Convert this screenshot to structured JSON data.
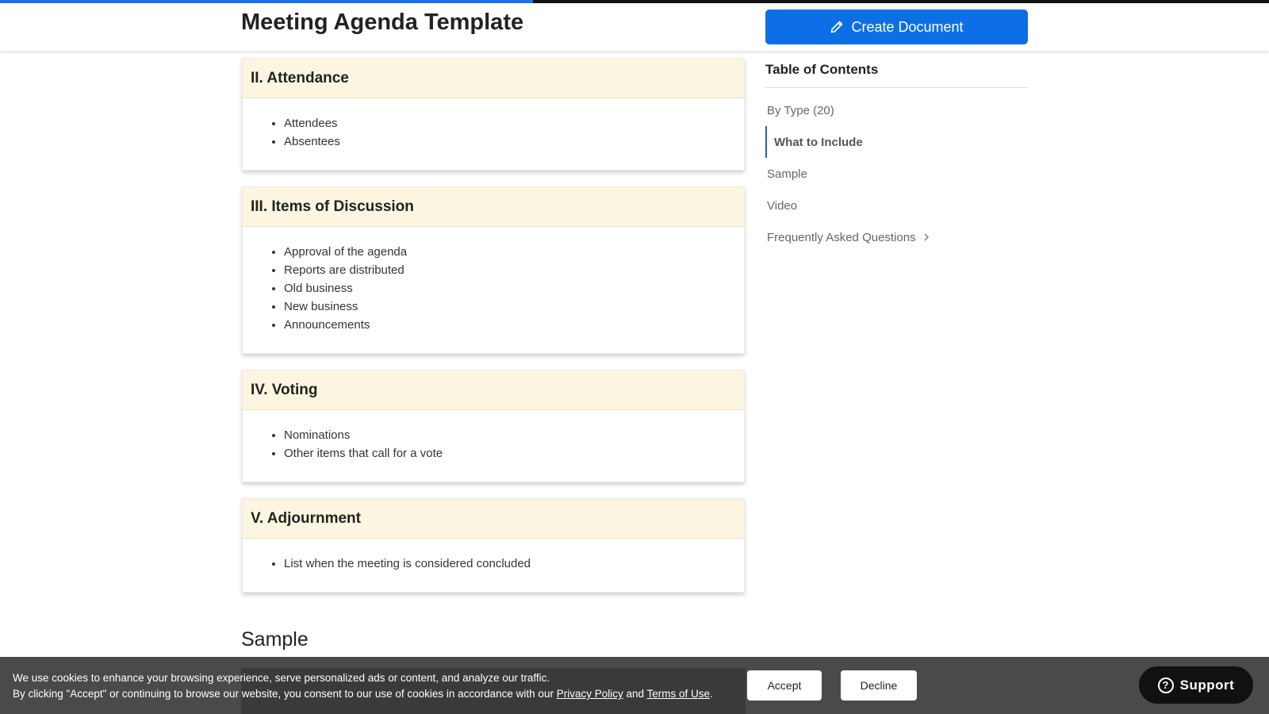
{
  "header": {
    "title": "Meeting Agenda Template",
    "create_button_label": "Create Document",
    "scroll_progress": 0.42
  },
  "sections": [
    {
      "heading": "II. Attendance",
      "items": [
        "Attendees",
        "Absentees"
      ]
    },
    {
      "heading": "III. Items of Discussion",
      "items": [
        "Approval of the agenda",
        "Reports are distributed",
        "Old business",
        "New business",
        "Announcements"
      ]
    },
    {
      "heading": "IV. Voting",
      "items": [
        "Nominations",
        "Other items that call for a vote"
      ]
    },
    {
      "heading": "V. Adjournment",
      "items": [
        "List when the meeting is considered concluded"
      ]
    }
  ],
  "sample_heading": "Sample",
  "toc": {
    "title": "Table of Contents",
    "items": [
      {
        "label": "By Type (20)",
        "active": false
      },
      {
        "label": "What to Include",
        "active": true
      },
      {
        "label": "Sample",
        "active": false
      },
      {
        "label": "Video",
        "active": false
      },
      {
        "label": "Frequently Asked Questions",
        "active": false
      }
    ]
  },
  "cookie_banner": {
    "line1": "We use cookies to enhance your browsing experience, serve personalized ads or content, and analyze our traffic.",
    "line2_prefix": "By clicking \"Accept\" or continuing to browse our website, you consent to our use of cookies in accordance with our ",
    "privacy_link": "Privacy Policy",
    "and_text": " and ",
    "terms_link": "Terms of Use",
    "period": ".",
    "accept_label": "Accept",
    "decline_label": "Decline"
  },
  "support": {
    "label": "Support"
  },
  "colors": {
    "brand_blue": "#0c6fe6",
    "section_header_bg": "#fcf6e0",
    "toc_active_border": "#2c5fa8"
  },
  "icons": {
    "create": "pencil-icon",
    "toc_expand": "chevron-right-icon",
    "support": "question-circle-icon"
  }
}
